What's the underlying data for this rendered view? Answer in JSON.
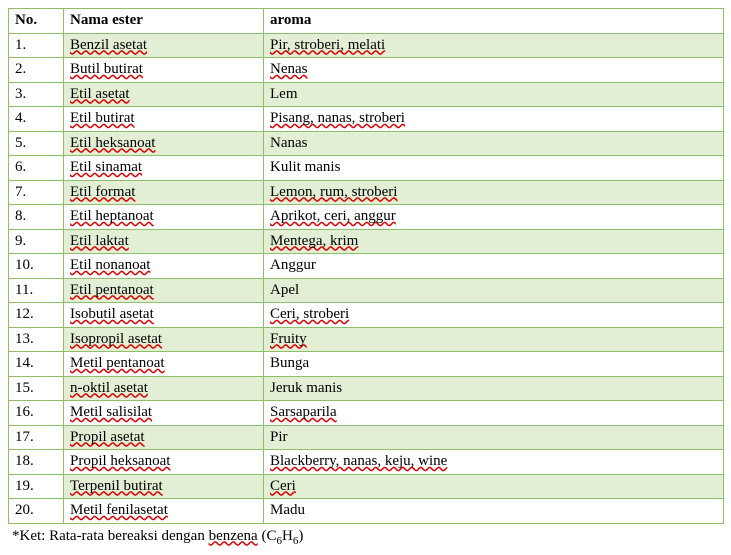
{
  "headers": {
    "no": "No.",
    "name": "Nama ester",
    "aroma": "aroma"
  },
  "rows": [
    {
      "no": "1.",
      "name": "Benzil asetat",
      "name_spell": true,
      "aroma": "Pir, stroberi, melati",
      "aroma_spell": true
    },
    {
      "no": "2.",
      "name": "Butil butirat",
      "name_spell": true,
      "aroma": "Nenas",
      "aroma_spell": true
    },
    {
      "no": "3.",
      "name": "Etil asetat",
      "name_spell": true,
      "aroma": "Lem",
      "aroma_spell": false
    },
    {
      "no": "4.",
      "name": "Etil butirat",
      "name_spell": true,
      "aroma": "Pisang, nanas, stroberi",
      "aroma_spell": true
    },
    {
      "no": "5.",
      "name": "Etil heksanoat",
      "name_spell": true,
      "aroma": "Nanas",
      "aroma_spell": false
    },
    {
      "no": "6.",
      "name": "Etil sinamat",
      "name_spell": true,
      "aroma": "Kulit manis",
      "aroma_spell": false
    },
    {
      "no": "7.",
      "name": "Etil format",
      "name_spell": true,
      "aroma": "Lemon, rum, stroberi",
      "aroma_spell": true
    },
    {
      "no": "8.",
      "name": "Etil heptanoat",
      "name_spell": true,
      "aroma": "Aprikot, ceri, anggur",
      "aroma_spell": true
    },
    {
      "no": "9.",
      "name": "Etil laktat",
      "name_spell": true,
      "aroma": "Mentega, krim",
      "aroma_spell": true
    },
    {
      "no": "10.",
      "name": "Etil nonanoat",
      "name_spell": true,
      "aroma": "Anggur",
      "aroma_spell": false
    },
    {
      "no": "11.",
      "name": "Etil pentanoat",
      "name_spell": true,
      "aroma": "Apel",
      "aroma_spell": false
    },
    {
      "no": "12.",
      "name": "Isobutil asetat",
      "name_spell": true,
      "aroma": "Ceri, stroberi",
      "aroma_spell": true
    },
    {
      "no": "13.",
      "name": "Isopropil asetat",
      "name_spell": true,
      "aroma": "Fruity",
      "aroma_spell": true
    },
    {
      "no": "14.",
      "name": "Metil pentanoat",
      "name_spell": true,
      "aroma": "Bunga",
      "aroma_spell": false
    },
    {
      "no": "15.",
      "name": "n-oktil asetat",
      "name_spell": true,
      "aroma": "Jeruk manis",
      "aroma_spell": false
    },
    {
      "no": "16.",
      "name": "Metil salisilat",
      "name_spell": true,
      "aroma": "Sarsaparila",
      "aroma_spell": true
    },
    {
      "no": "17.",
      "name": "Propil asetat",
      "name_spell": true,
      "aroma": "Pir",
      "aroma_spell": false
    },
    {
      "no": "18.",
      "name": "Propil heksanoat",
      "name_spell": true,
      "aroma": "Blackberry, nanas, keju, wine",
      "aroma_spell": true
    },
    {
      "no": "19.",
      "name": "Terpenil butirat",
      "name_spell": true,
      "aroma": "Ceri",
      "aroma_spell": true
    },
    {
      "no": "20.",
      "name": "Metil fenilasetat",
      "name_spell": true,
      "aroma": "Madu",
      "aroma_spell": false
    }
  ],
  "caption": {
    "prefix": "*Ket: Rata-rata bereaksi dengan ",
    "word": "benzena",
    "formula_plain": " (C6H6)"
  }
}
